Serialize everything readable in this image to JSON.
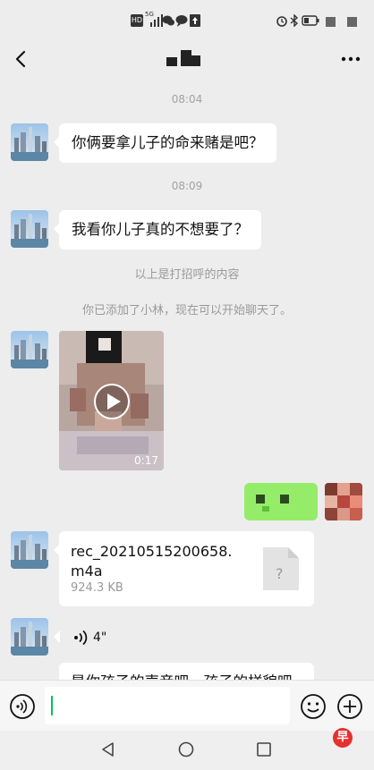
{
  "status_bar": {
    "hd": "HD",
    "net": "5G",
    "icons": [
      "hd-icon",
      "signal-icon",
      "wechat-notify-icon",
      "chat-notify-icon",
      "upload-icon",
      "alarm-icon",
      "bluetooth-icon",
      "battery-icon"
    ]
  },
  "header": {
    "back": "back-icon",
    "more": "more-icon"
  },
  "messages": {
    "time1": "08:04",
    "msg1": "你俩要拿儿子的命来赌是吧？",
    "time2": "08:09",
    "msg2": "我看你儿子真的不想要了？",
    "sys1": "以上是打招呼的内容",
    "sys2": "你已添加了小林，现在可以开始聊天了。",
    "video_duration": "0:17",
    "file_name_line1": "rec_20210515200658.",
    "file_name_line2": "m4a",
    "file_size": "924.3 KB",
    "file_icon_char": "?",
    "voice_duration": "4\"",
    "partial_msg": "是你孩子的声音吧，孩子的样貌吧"
  },
  "colors": {
    "accent_green": "#07c160",
    "green_bubble": "#95ec69",
    "bg": "#ededed"
  },
  "input_bar": {
    "voice": "voice-icon",
    "emoji": "emoji-icon",
    "plus": "plus-icon",
    "value": ""
  },
  "watermark": {
    "char": "早"
  }
}
